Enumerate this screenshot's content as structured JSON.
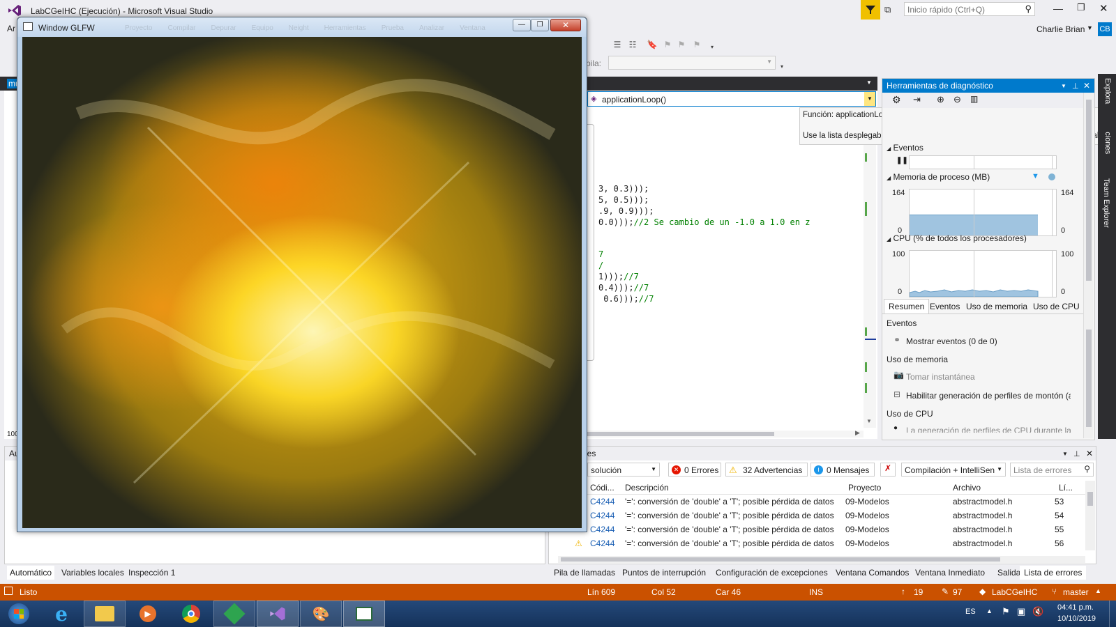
{
  "window": {
    "title": "LabCGeIHC (Ejecución) - Microsoft Visual Studio",
    "menu_partial": "Ar"
  },
  "quick_launch": {
    "placeholder": "Inicio rápido (Ctrl+Q)"
  },
  "user": {
    "name": "Charlie Brian",
    "initials": "CB"
  },
  "toolbar": {
    "stack_label": "pila:"
  },
  "glfw": {
    "title": "Window GLFW",
    "ghost_menu": [
      "Proyecto",
      "Compilar",
      "Depurar",
      "Equipo",
      "Neight",
      "Herramientas",
      "Prueba",
      "Analizar",
      "Ventana"
    ]
  },
  "editor": {
    "function_dropdown": "applicationLoop()",
    "tooltip": {
      "line1": "Función: applicationLoop()",
      "line2": "Use la lista desplegable para ver y navegar a todas las funciones de (Ámbito global)."
    },
    "code_lines": [
      {
        "code": "3, 0.3)));",
        "comment": ""
      },
      {
        "code": "5, 0.5)));",
        "comment": ""
      },
      {
        "code": ".9, 0.9)));",
        "comment": ""
      },
      {
        "code": "0.0)));",
        "comment": "//2 Se cambio de un -1.0 a 1.0 en z"
      },
      {
        "code": "",
        "comment": "7"
      },
      {
        "code": "",
        "comment": "/"
      },
      {
        "code": "1)));",
        "comment": "//7"
      },
      {
        "code": "0.4)));",
        "comment": "//7"
      },
      {
        "code": " 0.6)));",
        "comment": "//7"
      }
    ],
    "left_tab_fragment": "mu",
    "zoom_fragment": "100"
  },
  "diagnostics": {
    "title": "Herramientas de diagnóstico",
    "events_label": "Eventos",
    "memory_label": "Memoria de proceso (MB)",
    "memory_max": "164",
    "memory_min": "0",
    "cpu_label": "CPU (% de todos los procesadores)",
    "cpu_max": "100",
    "cpu_min": "0",
    "tabs": [
      "Resumen",
      "Eventos",
      "Uso de memoria",
      "Uso de CPU"
    ],
    "sections": {
      "events_header": "Eventos",
      "show_events": "Mostrar eventos (0 de 0)",
      "memory_header": "Uso de memoria",
      "snapshot": "Tomar instantánea",
      "heap_profiling": "Habilitar generación de perfiles de montón (a",
      "cpu_header": "Uso de CPU",
      "cpu_note": "La generación de perfiles de CPU durante la c"
    },
    "memory_level": 0.46
  },
  "side_tabs": [
    "Explorador de soluciones",
    "Team Explorer"
  ],
  "side_tab_visible": [
    "Explora",
    "ciones",
    "Team Explorer"
  ],
  "errors": {
    "title": "rrores",
    "scope": "solución",
    "errors_btn": "0 Errores",
    "warnings_btn": "32 Advertencias",
    "messages_btn": "0 Mensajes",
    "build_filter": "Compilación + IntelliSen",
    "search_placeholder": "Lista de errores",
    "columns": [
      "Códi...",
      "Descripción",
      "Proyecto",
      "Archivo",
      "Lí..."
    ],
    "rows": [
      {
        "code": "C4244",
        "desc": "'=': conversión de 'double' a 'T'; posible pérdida de datos",
        "project": "09-Modelos",
        "file": "abstractmodel.h",
        "line": "53"
      },
      {
        "code": "C4244",
        "desc": "'=': conversión de 'double' a 'T'; posible pérdida de datos",
        "project": "09-Modelos",
        "file": "abstractmodel.h",
        "line": "54"
      },
      {
        "code": "C4244",
        "desc": "'=': conversión de 'double' a 'T'; posible pérdida de datos",
        "project": "09-Modelos",
        "file": "abstractmodel.h",
        "line": "55"
      },
      {
        "code": "C4244",
        "desc": "'=': conversión de 'double' a 'T'; posible pérdida de datos",
        "project": "09-Modelos",
        "file": "abstractmodel.h",
        "line": "56"
      }
    ]
  },
  "bottom_left_tabs": [
    "Automático",
    "Variables locales",
    "Inspección 1"
  ],
  "bottom_left_fragment": "Au",
  "bottom_right_tabs": [
    "Pila de llamadas",
    "Puntos de interrupción",
    "Configuración de excepciones",
    "Ventana Comandos",
    "Ventana Inmediato",
    "Salida",
    "Lista de errores"
  ],
  "status": {
    "ready": "Listo",
    "line": "Lín 609",
    "col": "Col 52",
    "char": "Car 46",
    "ins": "INS",
    "up_count": "19",
    "pencil_count": "97",
    "repo": "LabCGeIHC",
    "branch": "master"
  },
  "taskbar": {
    "lang": "ES",
    "time": "04:41 p.m.",
    "date": "10/10/2019"
  },
  "colors": {
    "accent": "#007acc",
    "status": "#ca5100",
    "taskbar": "#1c3d6b"
  }
}
